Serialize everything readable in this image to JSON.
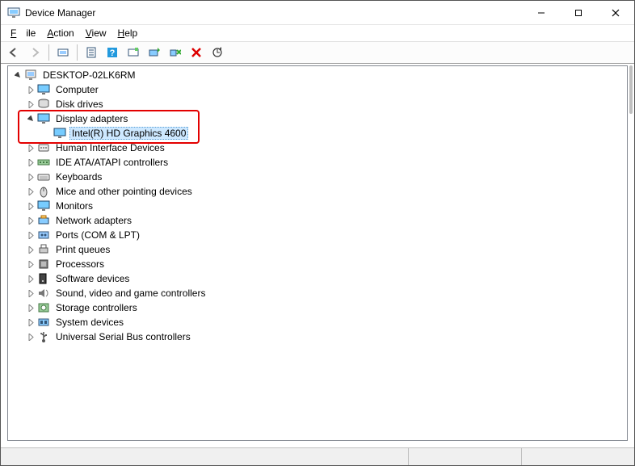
{
  "window": {
    "title": "Device Manager"
  },
  "menu": {
    "file_text": "File",
    "action_text": "Action",
    "view_text": "View",
    "help_text": "Help"
  },
  "toolbar": {
    "back": "Back",
    "forward": "Forward",
    "show_hidden": "Show hidden devices",
    "properties": "Properties",
    "help": "Help",
    "enable": "Enable device",
    "update": "Update driver",
    "uninstall": "Uninstall device",
    "disable": "Disable device",
    "scan": "Scan for hardware changes"
  },
  "tree": {
    "root": {
      "label": "DESKTOP-02LK6RM",
      "expanded": true
    },
    "items": [
      {
        "label": "Computer",
        "icon": "monitor",
        "expanded": false
      },
      {
        "label": "Disk drives",
        "icon": "disk",
        "expanded": false
      },
      {
        "label": "Display adapters",
        "icon": "monitor",
        "expanded": true,
        "children": [
          {
            "label": "Intel(R) HD Graphics 4600",
            "icon": "monitor",
            "selected": true
          }
        ]
      },
      {
        "label": "Human Interface Devices",
        "icon": "hid",
        "expanded": false
      },
      {
        "label": "IDE ATA/ATAPI controllers",
        "icon": "ide",
        "expanded": false
      },
      {
        "label": "Keyboards",
        "icon": "keyboard",
        "expanded": false
      },
      {
        "label": "Mice and other pointing devices",
        "icon": "mouse",
        "expanded": false
      },
      {
        "label": "Monitors",
        "icon": "monitor",
        "expanded": false
      },
      {
        "label": "Network adapters",
        "icon": "network",
        "expanded": false
      },
      {
        "label": "Ports (COM & LPT)",
        "icon": "port",
        "expanded": false
      },
      {
        "label": "Print queues",
        "icon": "printer",
        "expanded": false
      },
      {
        "label": "Processors",
        "icon": "cpu",
        "expanded": false
      },
      {
        "label": "Software devices",
        "icon": "software",
        "expanded": false
      },
      {
        "label": "Sound, video and game controllers",
        "icon": "sound",
        "expanded": false
      },
      {
        "label": "Storage controllers",
        "icon": "storage",
        "expanded": false
      },
      {
        "label": "System devices",
        "icon": "system",
        "expanded": false
      },
      {
        "label": "Universal Serial Bus controllers",
        "icon": "usb",
        "expanded": false
      }
    ]
  }
}
